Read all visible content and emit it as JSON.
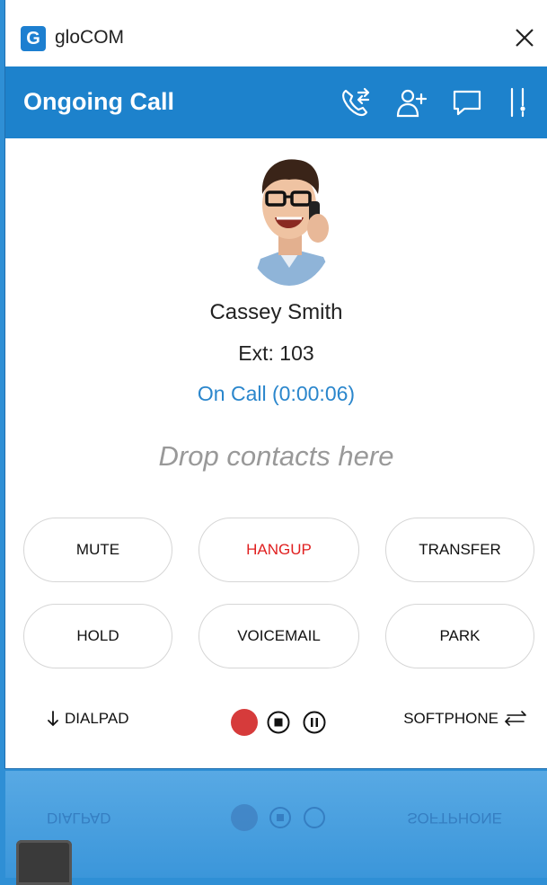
{
  "window": {
    "app_title": "gloCOM",
    "app_logo_letter": "G"
  },
  "header": {
    "title": "Ongoing Call",
    "icons": [
      "call-transfer-icon",
      "add-contact-icon",
      "chat-icon",
      "settings-sliders-icon"
    ]
  },
  "contact": {
    "name": "Cassey Smith",
    "ext": "Ext: 103",
    "status": "On Call (0:00:06)"
  },
  "drop_zone": {
    "text": "Drop contacts here"
  },
  "actions": {
    "mute": "MUTE",
    "hangup": "HANGUP",
    "transfer": "TRANSFER",
    "hold": "HOLD",
    "voicemail": "VOICEMAIL",
    "park": "PARK"
  },
  "bottom": {
    "dialpad": "DIALPAD",
    "softphone": "SOFTPHONE"
  },
  "colors": {
    "accent": "#1d82cc",
    "hangup": "#e01f1f",
    "record": "#d63b3b",
    "status": "#2a86cc"
  }
}
